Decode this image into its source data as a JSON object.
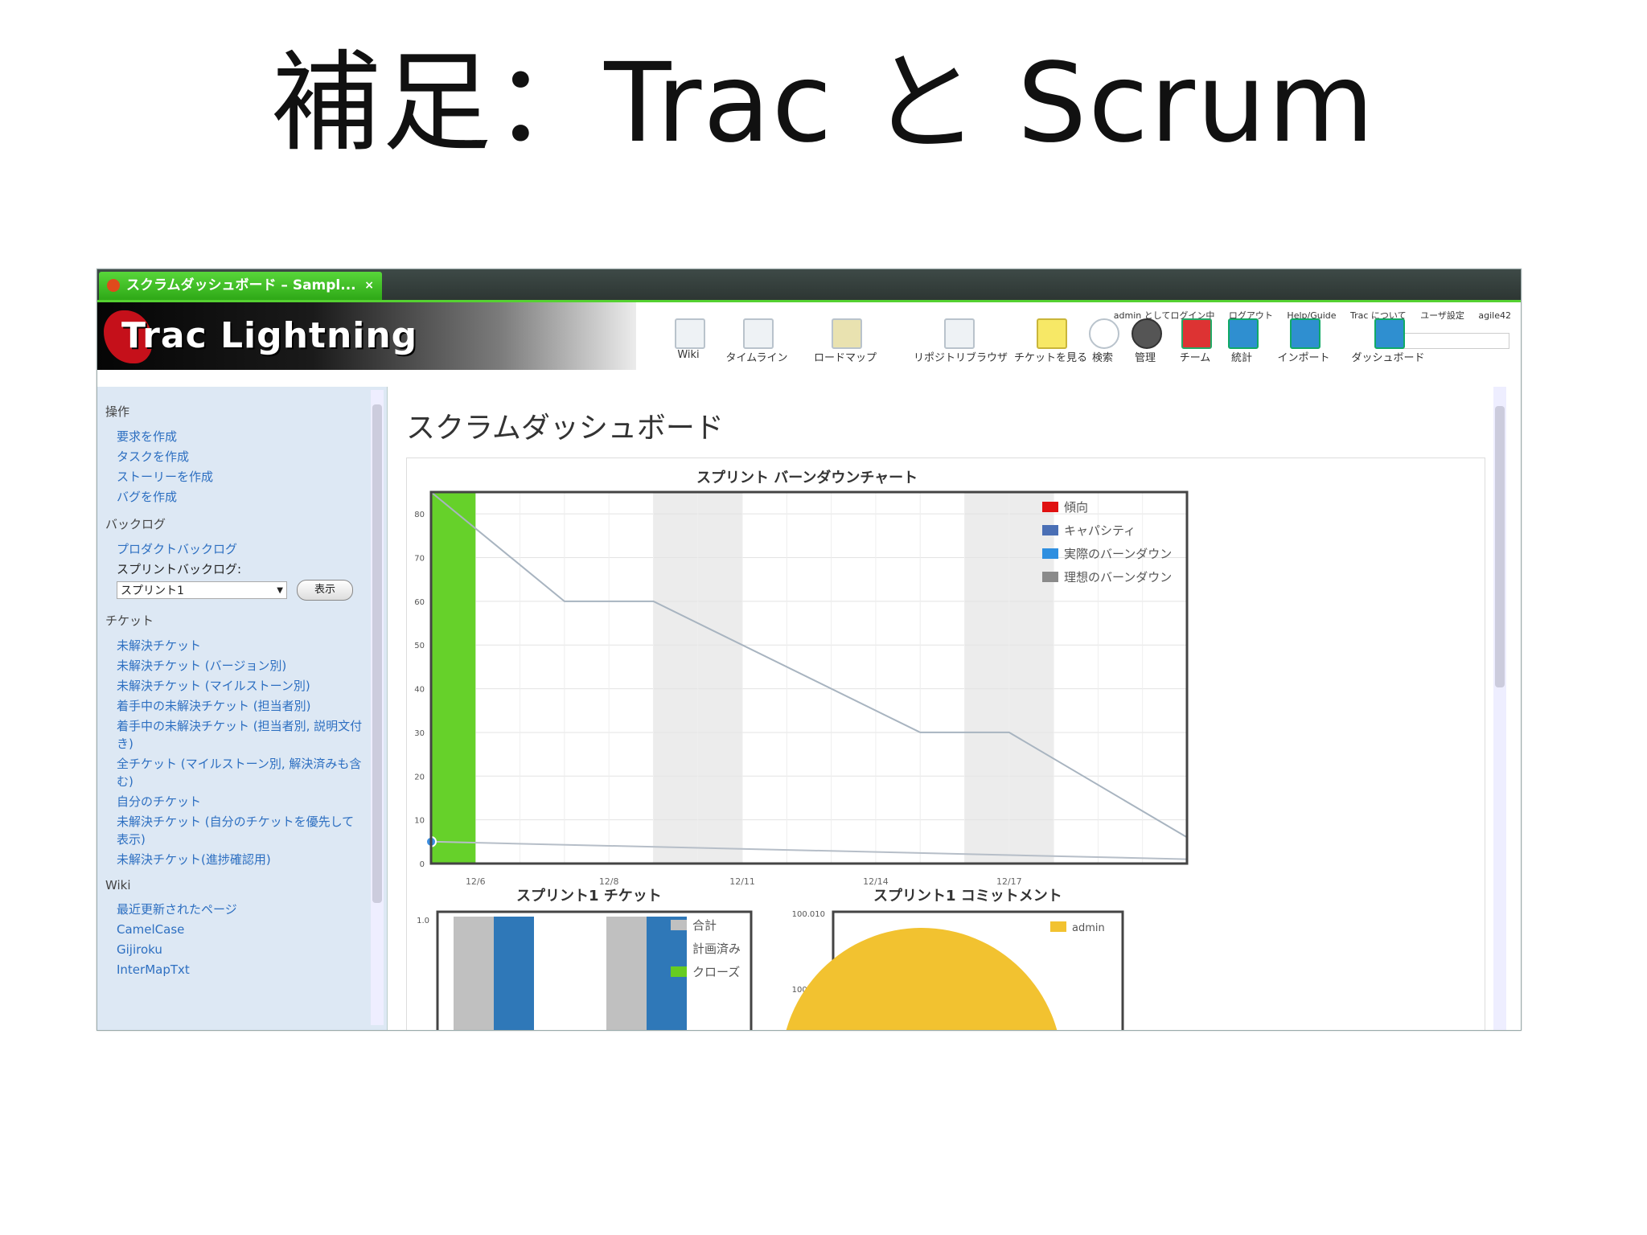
{
  "slide": {
    "title": "補足：Trac と Scrum"
  },
  "browser": {
    "tab_title": "スクラムダッシュボード – Sampl...",
    "tab_close": "×"
  },
  "banner": {
    "logo": "Trac Lightning",
    "metanav": [
      "admin としてログイン中",
      "ログアウト",
      "Help/Guide",
      "Trac について",
      "ユーザ設定",
      "agile42"
    ],
    "toolbar": [
      "Wiki",
      "タイムライン",
      "ロードマップ",
      "リポジトリブラウザ",
      "チケットを見る",
      "検索",
      "管理",
      "チーム",
      "統計",
      "インポート",
      "ダッシュボード"
    ]
  },
  "sidebar": {
    "section_ops": "操作",
    "ops_links": [
      "要求を作成",
      "タスクを作成",
      "ストーリーを作成",
      "バグを作成"
    ],
    "section_backlog": "バックログ",
    "product_backlog": "プロダクトバックログ",
    "sprint_backlog_label": "スプリントバックログ:",
    "sprint_select_value": "スプリント1",
    "show_button": "表示",
    "section_tickets": "チケット",
    "ticket_links": [
      "未解決チケット",
      "未解決チケット (バージョン別)",
      "未解決チケット (マイルストーン別)",
      "着手中の未解決チケット (担当者別)",
      "着手中の未解決チケット (担当者別, 説明文付き)",
      "全チケット (マイルストーン別, 解決済みも含む)",
      "自分のチケット",
      "未解決チケット (自分のチケットを優先して表示)",
      "未解決チケット(進捗確認用)"
    ],
    "section_wiki": "Wiki",
    "wiki_links": [
      "最近更新されたページ",
      "CamelCase",
      "Gijiroku",
      "InterMapTxt"
    ]
  },
  "main": {
    "page_title": "スクラムダッシュボード"
  },
  "chart_data": [
    {
      "type": "line",
      "title": "スプリント バーンダウンチャート",
      "x": [
        "12/6",
        "12/8",
        "12/11",
        "12/14",
        "12/17"
      ],
      "ylim": [
        0,
        85
      ],
      "yticks": [
        0,
        10,
        20,
        30,
        40,
        50,
        60,
        70,
        80
      ],
      "legend": [
        "傾向",
        "キャパシティ",
        "実際のバーンダウン",
        "理想のバーンダウン"
      ],
      "legend_colors": [
        "#e01010",
        "#4a6fb5",
        "#2f8fe0",
        "#8a8a8a"
      ],
      "series": [
        {
          "name": "理想のバーンダウン",
          "points": [
            [
              0,
              85
            ],
            [
              3,
              60
            ],
            [
              5,
              60
            ],
            [
              11,
              30
            ],
            [
              13,
              30
            ],
            [
              17,
              6
            ]
          ]
        },
        {
          "name": "実際のバーンダウン",
          "points": [
            [
              0,
              5
            ],
            [
              17,
              1
            ]
          ]
        }
      ]
    },
    {
      "type": "bar",
      "title": "スプリント1 チケット",
      "ylim": [
        0,
        1.0
      ],
      "yticks": [
        "1.0"
      ],
      "series": [
        {
          "name": "合計",
          "color": "#c0c0c0"
        },
        {
          "name": "計画済み",
          "color": "#2f78b8"
        },
        {
          "name": "クローズ",
          "color": "#66cc22"
        }
      ]
    },
    {
      "type": "pie",
      "title": "スプリント1 コミットメント",
      "yticks": [
        "100.010",
        "100.005"
      ],
      "series": [
        {
          "name": "admin",
          "color": "#f2c230"
        }
      ]
    }
  ]
}
